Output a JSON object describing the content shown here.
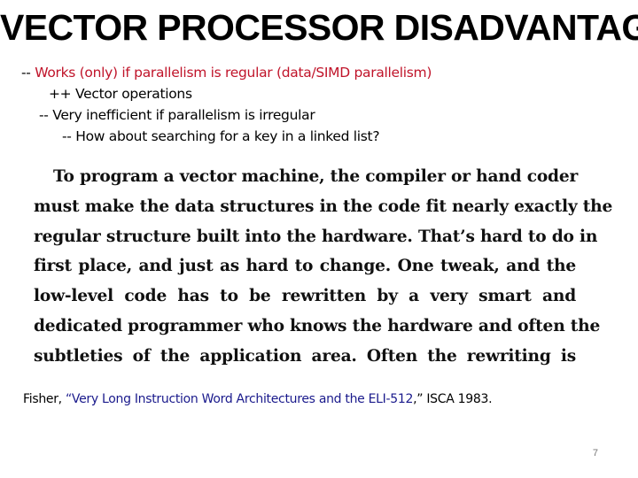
{
  "slide": {
    "title": "VECTOR PROCESSOR DISADVANTAGES",
    "bullets": [
      {
        "prefix": "-- ",
        "text": "Works (only) if parallelism is regular (data/SIMD parallelism)",
        "color": "#c0142a"
      },
      {
        "prefix": "++ ",
        "text": "Vector operations"
      },
      {
        "prefix": "-- ",
        "text": "Very inefficient if parallelism is irregular"
      },
      {
        "prefix": "-- ",
        "text": "How about searching for a key in a linked list?"
      }
    ],
    "quote_lines": [
      "To program a vector machine, the compiler or hand coder",
      "must make the data structures in the code fit nearly exactly the",
      "regular structure built into the hardware.  That’s hard to do in",
      "first place, and just as hard to change.  One tweak, and the",
      "low-level code has to be rewritten by a very smart and",
      "dedicated programmer who knows the hardware and often the",
      "subtleties of the application area.  Often the rewriting is"
    ],
    "citation": {
      "author": "Fisher, ",
      "title": "“Very Long Instruction Word Architectures and the ELI-512",
      "venue": ",” ISCA 1983."
    },
    "page_number": "7"
  },
  "colors": {
    "accent_red": "#c0142a",
    "citation_blue": "#1a1a8c"
  }
}
